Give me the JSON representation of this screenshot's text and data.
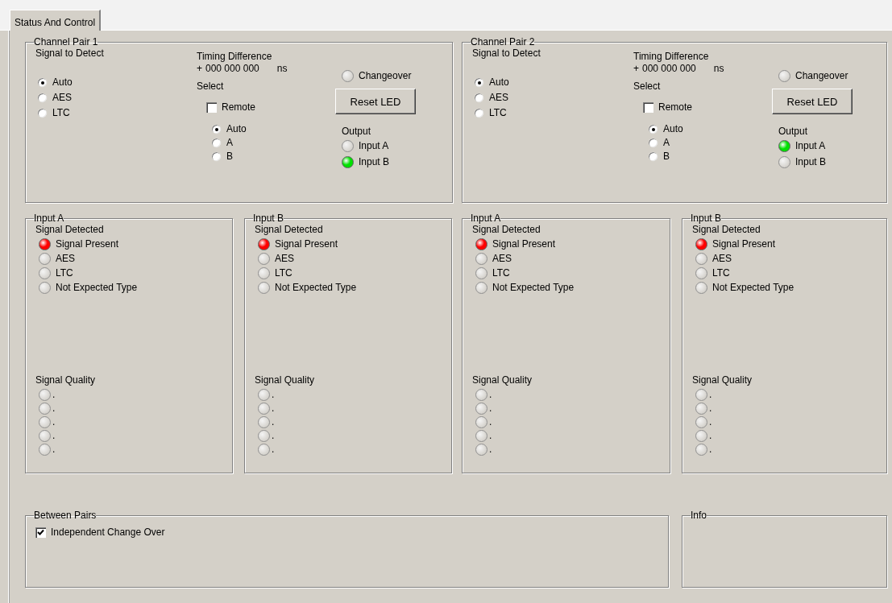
{
  "tabs": [
    {
      "label": "Status And Control",
      "selected": true
    }
  ],
  "channel_pairs": [
    {
      "title": "Channel Pair 1",
      "signal_to_detect": {
        "label": "Signal to Detect",
        "options": [
          {
            "label": "Auto",
            "selected": true
          },
          {
            "label": "AES",
            "selected": false
          },
          {
            "label": "LTC",
            "selected": false
          }
        ]
      },
      "timing": {
        "label": "Timing Difference",
        "sign": "+",
        "value": "000 000 000",
        "unit": "ns"
      },
      "select": {
        "label": "Select",
        "remote": {
          "label": "Remote",
          "checked": false
        },
        "options": [
          {
            "label": "Auto",
            "selected": true
          },
          {
            "label": "A",
            "selected": false
          },
          {
            "label": "B",
            "selected": false
          }
        ]
      },
      "changeover": {
        "label": "Changeover",
        "on": false
      },
      "reset_button": "Reset LED",
      "output": {
        "label": "Output",
        "items": [
          {
            "label": "Input A",
            "on": false
          },
          {
            "label": "Input B",
            "on": true,
            "color": "#00e000"
          }
        ]
      }
    },
    {
      "title": "Channel Pair 2",
      "signal_to_detect": {
        "label": "Signal to Detect",
        "options": [
          {
            "label": "Auto",
            "selected": true
          },
          {
            "label": "AES",
            "selected": false
          },
          {
            "label": "LTC",
            "selected": false
          }
        ]
      },
      "timing": {
        "label": "Timing Difference",
        "sign": "+",
        "value": "000 000 000",
        "unit": "ns"
      },
      "select": {
        "label": "Select",
        "remote": {
          "label": "Remote",
          "checked": false
        },
        "options": [
          {
            "label": "Auto",
            "selected": true
          },
          {
            "label": "A",
            "selected": false
          },
          {
            "label": "B",
            "selected": false
          }
        ]
      },
      "changeover": {
        "label": "Changeover",
        "on": false
      },
      "reset_button": "Reset LED",
      "output": {
        "label": "Output",
        "items": [
          {
            "label": "Input A",
            "on": true,
            "color": "#00e000"
          },
          {
            "label": "Input B",
            "on": false
          }
        ]
      }
    }
  ],
  "inputs": [
    {
      "title": "Input A",
      "detected": {
        "label": "Signal Detected",
        "items": [
          {
            "label": "Signal Present",
            "on": true,
            "color": "#ff0000"
          },
          {
            "label": "AES",
            "on": false
          },
          {
            "label": "LTC",
            "on": false
          },
          {
            "label": "Not Expected Type",
            "on": false
          }
        ]
      },
      "quality": {
        "label": "Signal Quality",
        "items": [
          {
            "label": ".",
            "on": false
          },
          {
            "label": ".",
            "on": false
          },
          {
            "label": ".",
            "on": false
          },
          {
            "label": ".",
            "on": false
          },
          {
            "label": ".",
            "on": false
          }
        ]
      }
    },
    {
      "title": "Input B",
      "detected": {
        "label": "Signal Detected",
        "items": [
          {
            "label": "Signal Present",
            "on": true,
            "color": "#ff0000"
          },
          {
            "label": "AES",
            "on": false
          },
          {
            "label": "LTC",
            "on": false
          },
          {
            "label": "Not Expected Type",
            "on": false
          }
        ]
      },
      "quality": {
        "label": "Signal Quality",
        "items": [
          {
            "label": ".",
            "on": false
          },
          {
            "label": ".",
            "on": false
          },
          {
            "label": ".",
            "on": false
          },
          {
            "label": ".",
            "on": false
          },
          {
            "label": ".",
            "on": false
          }
        ]
      }
    },
    {
      "title": "Input A",
      "detected": {
        "label": "Signal Detected",
        "items": [
          {
            "label": "Signal Present",
            "on": true,
            "color": "#ff0000"
          },
          {
            "label": "AES",
            "on": false
          },
          {
            "label": "LTC",
            "on": false
          },
          {
            "label": "Not Expected Type",
            "on": false
          }
        ]
      },
      "quality": {
        "label": "Signal Quality",
        "items": [
          {
            "label": ".",
            "on": false
          },
          {
            "label": ".",
            "on": false
          },
          {
            "label": ".",
            "on": false
          },
          {
            "label": ".",
            "on": false
          },
          {
            "label": ".",
            "on": false
          }
        ]
      }
    },
    {
      "title": "Input B",
      "detected": {
        "label": "Signal Detected",
        "items": [
          {
            "label": "Signal Present",
            "on": true,
            "color": "#ff0000"
          },
          {
            "label": "AES",
            "on": false
          },
          {
            "label": "LTC",
            "on": false
          },
          {
            "label": "Not Expected Type",
            "on": false
          }
        ]
      },
      "quality": {
        "label": "Signal Quality",
        "items": [
          {
            "label": ".",
            "on": false
          },
          {
            "label": ".",
            "on": false
          },
          {
            "label": ".",
            "on": false
          },
          {
            "label": ".",
            "on": false
          },
          {
            "label": ".",
            "on": false
          }
        ]
      }
    }
  ],
  "between_pairs": {
    "title": "Between Pairs",
    "checkbox": {
      "label": "Independent Change Over",
      "checked": true
    }
  },
  "info": {
    "title": "Info"
  }
}
